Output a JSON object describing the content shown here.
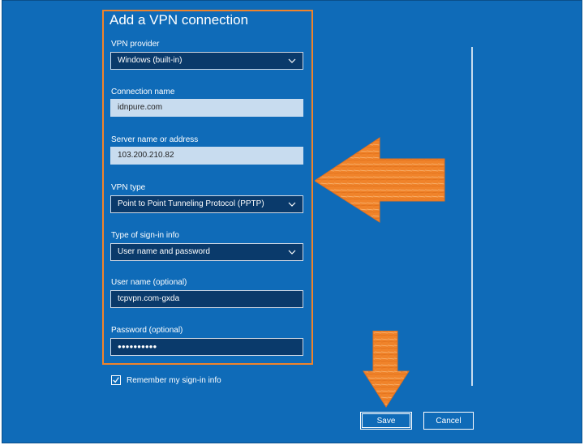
{
  "dialog": {
    "title": "Add a VPN connection",
    "vpn_provider": {
      "label": "VPN provider",
      "value": "Windows (built-in)"
    },
    "connection_name": {
      "label": "Connection name",
      "value": "idnpure.com"
    },
    "server_address": {
      "label": "Server name or address",
      "value": "103.200.210.82"
    },
    "vpn_type": {
      "label": "VPN type",
      "value": "Point to Point Tunneling Protocol (PPTP)"
    },
    "signin_type": {
      "label": "Type of sign-in info",
      "value": "User name and password"
    },
    "username": {
      "label": "User name (optional)",
      "value": "tcpvpn.com-gxda"
    },
    "password": {
      "label": "Password (optional)",
      "value": "●●●●●●●●●●"
    },
    "remember": {
      "label": "Remember my sign-in info",
      "checked": true
    }
  },
  "buttons": {
    "save": "Save",
    "cancel": "Cancel"
  },
  "colors": {
    "background": "#0f6bb8",
    "field_dark": "#0a3a6b",
    "field_light": "#c8dcef",
    "annotation": "#f0832a"
  },
  "icons": {
    "dropdown": "chevron-down-icon",
    "checkbox": "check-icon",
    "annotation_left": "arrow-left-icon",
    "annotation_down": "arrow-down-icon"
  }
}
